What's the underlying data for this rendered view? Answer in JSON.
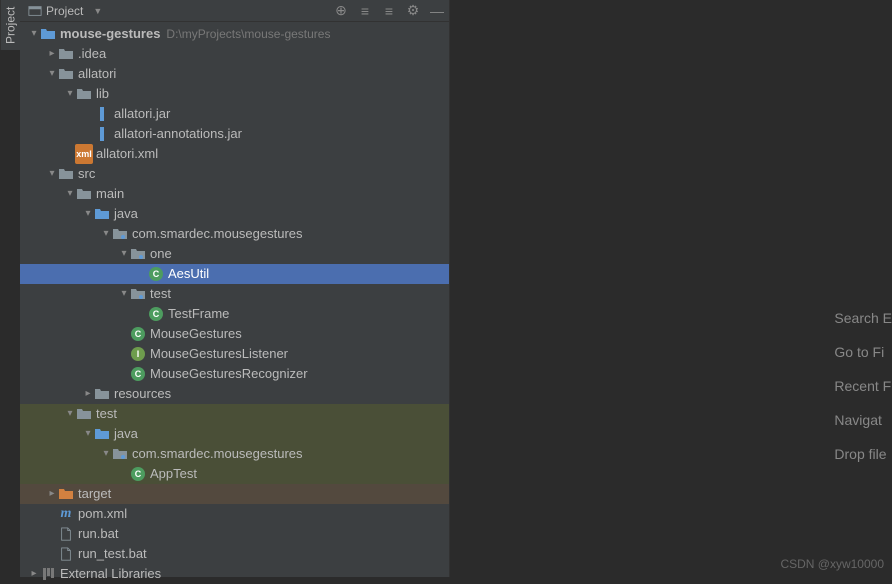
{
  "sidebarTab": "Project",
  "panel": {
    "title": "Project"
  },
  "toolbar": {
    "locate": "⊕",
    "collapse": "≡",
    "expand": "≡",
    "settings": "⚙",
    "hide": "—"
  },
  "tree": [
    {
      "depth": 0,
      "arrow": "expanded",
      "icon": "module",
      "label": "mouse-gestures",
      "hint": "D:\\myProjects\\mouse-gestures",
      "bold": true
    },
    {
      "depth": 1,
      "arrow": "collapsed",
      "icon": "folder",
      "label": ".idea"
    },
    {
      "depth": 1,
      "arrow": "expanded",
      "icon": "folder",
      "label": "allatori"
    },
    {
      "depth": 2,
      "arrow": "expanded",
      "icon": "folder",
      "label": "lib"
    },
    {
      "depth": 3,
      "arrow": "none",
      "icon": "jar",
      "label": "allatori.jar"
    },
    {
      "depth": 3,
      "arrow": "none",
      "icon": "jar",
      "label": "allatori-annotations.jar"
    },
    {
      "depth": 2,
      "arrow": "none",
      "icon": "xml",
      "label": "allatori.xml"
    },
    {
      "depth": 1,
      "arrow": "expanded",
      "icon": "folder",
      "label": "src"
    },
    {
      "depth": 2,
      "arrow": "expanded",
      "icon": "folder",
      "label": "main"
    },
    {
      "depth": 3,
      "arrow": "expanded",
      "icon": "folder-src",
      "label": "java"
    },
    {
      "depth": 4,
      "arrow": "expanded",
      "icon": "package",
      "label": "com.smardec.mousegestures"
    },
    {
      "depth": 5,
      "arrow": "expanded",
      "icon": "package",
      "label": "one"
    },
    {
      "depth": 6,
      "arrow": "none",
      "icon": "class",
      "label": "AesUtil",
      "selected": true
    },
    {
      "depth": 5,
      "arrow": "expanded",
      "icon": "package",
      "label": "test"
    },
    {
      "depth": 6,
      "arrow": "none",
      "icon": "class",
      "label": "TestFrame"
    },
    {
      "depth": 5,
      "arrow": "none",
      "icon": "class",
      "label": "MouseGestures"
    },
    {
      "depth": 5,
      "arrow": "none",
      "icon": "interface",
      "label": "MouseGesturesListener"
    },
    {
      "depth": 5,
      "arrow": "none",
      "icon": "class",
      "label": "MouseGesturesRecognizer"
    },
    {
      "depth": 3,
      "arrow": "collapsed",
      "icon": "folder-res",
      "label": "resources"
    },
    {
      "depth": 2,
      "arrow": "expanded",
      "icon": "folder",
      "label": "test",
      "hl": "test"
    },
    {
      "depth": 3,
      "arrow": "expanded",
      "icon": "folder-src",
      "label": "java",
      "hl": "test"
    },
    {
      "depth": 4,
      "arrow": "expanded",
      "icon": "package",
      "label": "com.smardec.mousegestures",
      "hl": "test"
    },
    {
      "depth": 5,
      "arrow": "none",
      "icon": "class",
      "label": "AppTest",
      "hl": "test"
    },
    {
      "depth": 1,
      "arrow": "collapsed",
      "icon": "folder-target",
      "label": "target",
      "hl": "target"
    },
    {
      "depth": 1,
      "arrow": "none",
      "icon": "maven",
      "label": "pom.xml"
    },
    {
      "depth": 1,
      "arrow": "none",
      "icon": "file",
      "label": "run.bat"
    },
    {
      "depth": 1,
      "arrow": "none",
      "icon": "file",
      "label": "run_test.bat"
    },
    {
      "depth": 0,
      "arrow": "collapsed",
      "icon": "libs",
      "label": "External Libraries"
    }
  ],
  "hints": {
    "search": "Search E",
    "goto": "Go to Fi",
    "recent": "Recent F",
    "nav": "Navigat",
    "drop": "Drop file"
  },
  "watermark": "CSDN @xyw10000"
}
